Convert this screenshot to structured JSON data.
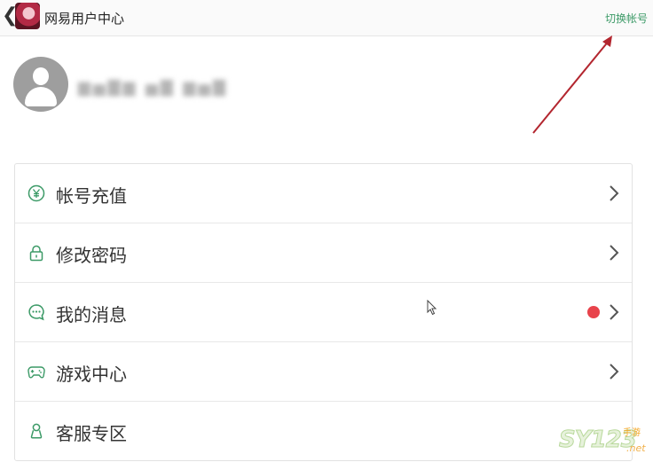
{
  "topbar": {
    "back_icon": "chevron-left-icon",
    "app_icon": "game-avatar-icon",
    "title": "网易用户中心",
    "switch_account": "切换帐号"
  },
  "profile": {
    "avatar_icon": "user-avatar-icon",
    "username_redacted": "▆▅▇▆ ▅▇ ▆▅▇"
  },
  "menu": {
    "items": [
      {
        "label": "帐号充值",
        "icon": "yen-coin-icon",
        "has_badge": false
      },
      {
        "label": "修改密码",
        "icon": "lock-icon",
        "has_badge": false
      },
      {
        "label": "我的消息",
        "icon": "chat-bubble-icon",
        "has_badge": true
      },
      {
        "label": "游戏中心",
        "icon": "gamepad-icon",
        "has_badge": false
      },
      {
        "label": "客服专区",
        "icon": "support-icon",
        "has_badge": false
      }
    ]
  },
  "watermark": {
    "main": "SY123",
    "sub": "手游",
    "net": ".net"
  },
  "colors": {
    "accent": "#3c9a67",
    "badge": "#e8434b",
    "annotation_arrow": "#b3262f"
  }
}
